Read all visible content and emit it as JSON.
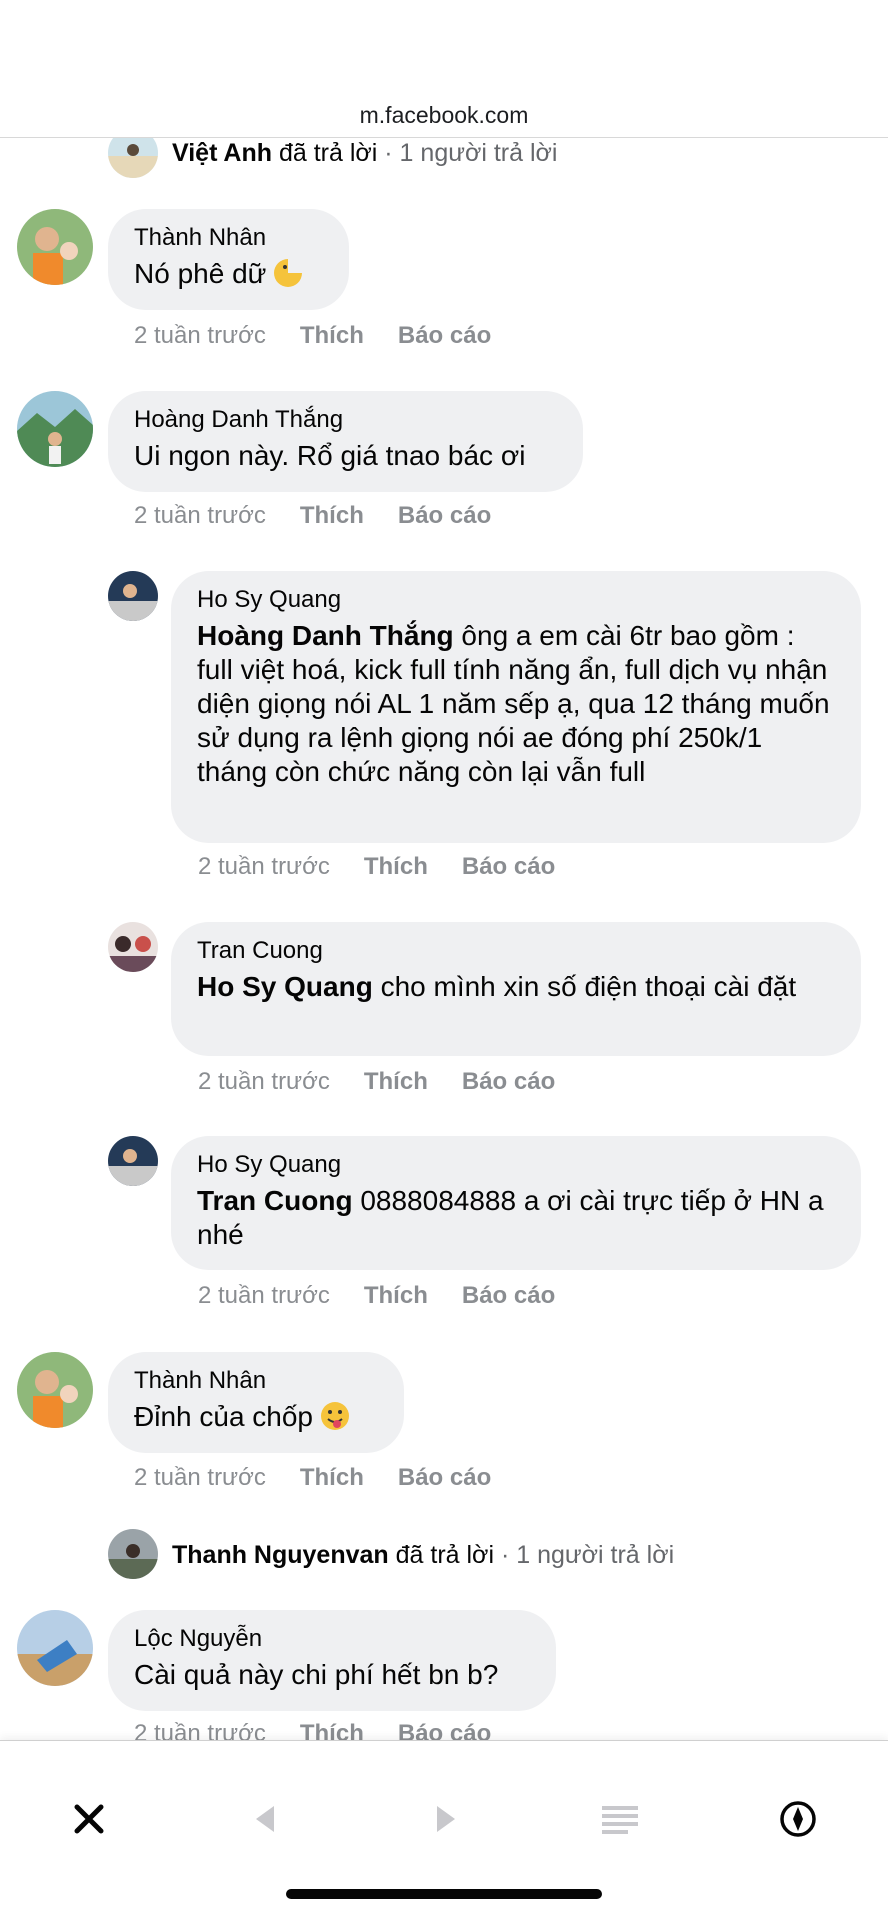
{
  "browser": {
    "url": "m.facebook.com"
  },
  "top_reply": {
    "name": "Việt Anh",
    "action": " đã trả lời",
    "count": " · 1 người trả lời"
  },
  "comments": [
    {
      "name": "Thành Nhân",
      "text": "Nó phê dữ",
      "time": "2 tuần trước",
      "like": "Thích",
      "report": "Báo cáo"
    },
    {
      "name": "Hoàng Danh Thắng",
      "text": "Ui ngon này. Rổ giá tnao bác ơi",
      "time": "2 tuần trước",
      "like": "Thích",
      "report": "Báo cáo"
    },
    {
      "name": "Ho Sy Quang",
      "mention": "Hoàng Danh Thắng",
      "text": " ông a em cài 6tr bao gồm : full việt hoá, kick full tính năng ẩn, full dịch vụ nhận diện giọng nói AL 1 năm sếp ạ, qua 12 tháng muốn sử dụng ra lệnh giọng nói ae đóng phí 250k/1 tháng còn chức năng còn lại vẫn full",
      "time": "2 tuần trước",
      "like": "Thích",
      "report": "Báo cáo"
    },
    {
      "name": "Tran Cuong",
      "mention": "Ho Sy Quang",
      "text": " cho mình xin số điện thoại cài đặt",
      "time": "2 tuần trước",
      "like": "Thích",
      "report": "Báo cáo"
    },
    {
      "name": "Ho Sy Quang",
      "mention": "Tran Cuong",
      "text": " 0888084888 a ơi cài trực tiếp ở HN a nhé",
      "time": "2 tuần trước",
      "like": "Thích",
      "report": "Báo cáo"
    },
    {
      "name": "Thành Nhân",
      "text": "Đỉnh của chốp",
      "time": "2 tuần trước",
      "like": "Thích",
      "report": "Báo cáo"
    },
    {
      "name": "Lộc Nguyễn",
      "text": "Cài quả này chi phí hết bn b?",
      "time": "2 tuần trước",
      "like": "Thích",
      "report": "Báo cáo"
    }
  ],
  "mid_reply": {
    "name": "Thanh Nguyenvan",
    "action": " đã trả lời",
    "count": " · 1 người trả lời"
  },
  "toolbar": {
    "close": "close-icon",
    "back": "back-icon",
    "forward": "forward-icon",
    "menu": "menu-icon",
    "compass": "compass-icon"
  },
  "colors": {
    "bubble": "#eff0f2",
    "meta": "#8a8d91",
    "text": "#050505"
  }
}
